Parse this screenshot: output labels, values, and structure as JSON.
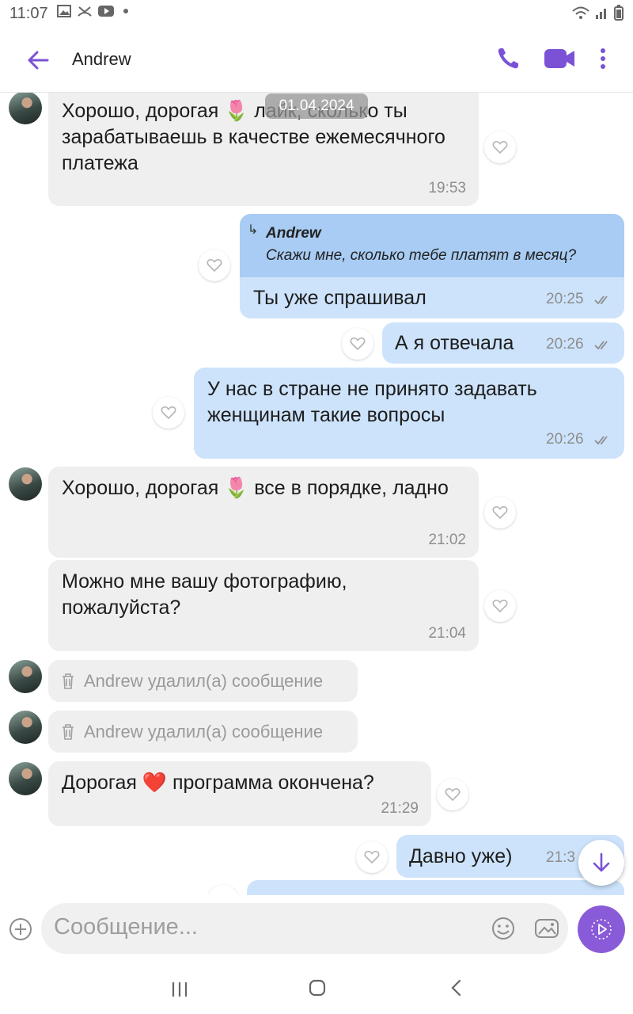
{
  "status_bar": {
    "time": "11:07"
  },
  "header": {
    "contact_name": "Andrew"
  },
  "date_chip": "01.04.2024",
  "messages": [
    {
      "dir": "in",
      "text": "Хорошо, дорогая 🌷 лайк, сколько ты зарабатываешь в качестве ежемесячного платежа",
      "time": "19:53"
    },
    {
      "dir": "out",
      "reply_to": {
        "name": "Andrew",
        "text": "Скажи мне, сколько тебе платят в месяц?"
      },
      "text": "Ты уже спрашивал",
      "time": "20:25"
    },
    {
      "dir": "out",
      "text": "А я отвечала",
      "time": "20:26"
    },
    {
      "dir": "out",
      "text": "У нас в стране не принято задавать женщинам такие вопросы",
      "time": "20:26"
    },
    {
      "dir": "in",
      "text": "Хорошо, дорогая 🌷 все в порядке, ладно",
      "time": "21:02"
    },
    {
      "dir": "in",
      "text": "Можно мне вашу фотографию, пожалуйста?",
      "time": "21:04"
    },
    {
      "dir": "in",
      "deleted": true,
      "text": "Andrew удалил(а) сообщение"
    },
    {
      "dir": "in",
      "deleted": true,
      "text": "Andrew удалил(а) сообщение"
    },
    {
      "dir": "in",
      "text": "Дорогая ❤️ программа окончена?",
      "time": "21:29"
    },
    {
      "dir": "out",
      "text": "Давно уже)",
      "time": "21:3"
    }
  ],
  "composer": {
    "placeholder": "Сообщение..."
  },
  "colors": {
    "accent": "#7b52d6",
    "incoming_bubble": "#efefef",
    "outgoing_bubble": "#cde3fb",
    "reply_header": "#a8ccf3"
  },
  "icons": [
    "back-arrow-icon",
    "phone-icon",
    "video-icon",
    "more-vert-icon",
    "heart-icon",
    "trash-icon",
    "plus-icon",
    "smile-icon",
    "gallery-icon",
    "send-icon",
    "chevron-down-icon"
  ]
}
